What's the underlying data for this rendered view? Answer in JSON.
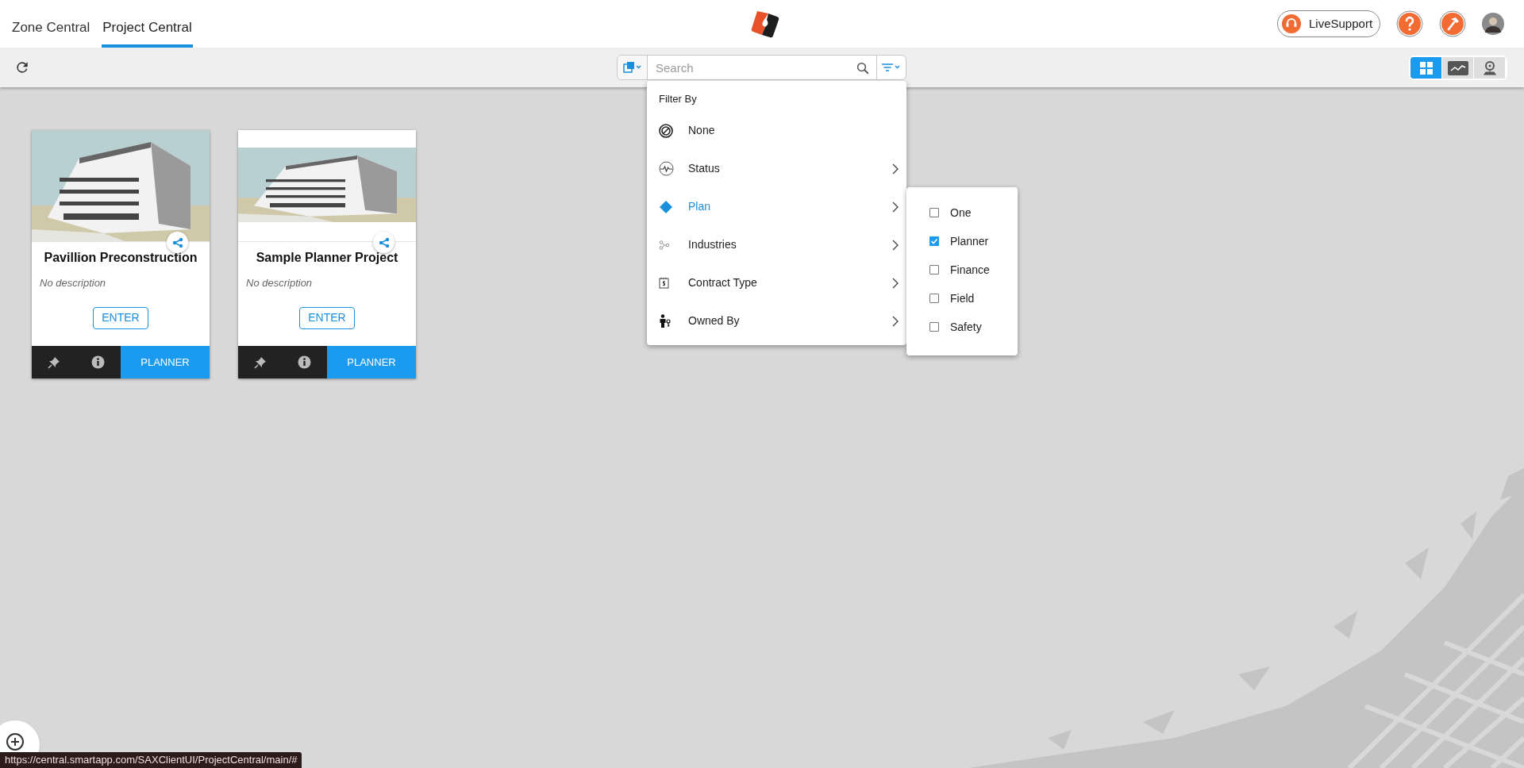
{
  "header": {
    "tabs": [
      {
        "label": "Zone Central",
        "selected": false
      },
      {
        "label": "Project Central",
        "selected": true
      }
    ],
    "live_support": "LiveSupport"
  },
  "toolbar": {
    "search": {
      "placeholder": "Search"
    },
    "views": [
      {
        "kind": "grid",
        "selected": true
      },
      {
        "kind": "chart",
        "selected": false
      },
      {
        "kind": "map",
        "selected": false
      }
    ]
  },
  "filter_menu": {
    "title": "Filter By",
    "items": [
      {
        "kind": "none",
        "label": "None",
        "has_submenu": false,
        "selected": false
      },
      {
        "kind": "status",
        "label": "Status",
        "has_submenu": true,
        "selected": false
      },
      {
        "kind": "plan",
        "label": "Plan",
        "has_submenu": true,
        "selected": true
      },
      {
        "kind": "industries",
        "label": "Industries",
        "has_submenu": true,
        "selected": false
      },
      {
        "kind": "contract",
        "label": "Contract Type",
        "has_submenu": true,
        "selected": false
      },
      {
        "kind": "owner",
        "label": "Owned By",
        "has_submenu": true,
        "selected": false
      }
    ]
  },
  "plan_submenu": [
    {
      "label": "One",
      "checked": false
    },
    {
      "label": "Planner",
      "checked": true
    },
    {
      "label": "Finance",
      "checked": false
    },
    {
      "label": "Field",
      "checked": false
    },
    {
      "label": "Safety",
      "checked": false
    }
  ],
  "projects": [
    {
      "name": "Pavillion Preconstruction",
      "description": "No description",
      "enter": "ENTER",
      "module": "PLANNER",
      "kind": "full"
    },
    {
      "name": "Sample Planner Project",
      "description": "No description",
      "enter": "ENTER",
      "module": "PLANNER",
      "kind": "letterbox"
    }
  ],
  "status_url": "https://central.smartapp.com/SAXClientUI/ProjectCentral/main/#"
}
